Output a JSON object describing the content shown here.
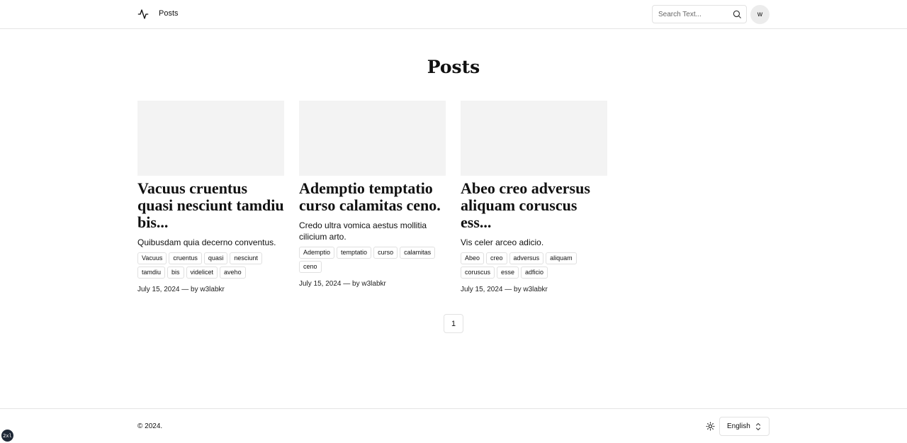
{
  "header": {
    "logo_icon": "activity-pulse-icon",
    "nav": {
      "posts_label": "Posts"
    },
    "search": {
      "placeholder": "Search Text...",
      "value": "",
      "icon": "search-icon"
    },
    "avatar_initial": "w"
  },
  "page": {
    "title": "Posts"
  },
  "posts": [
    {
      "title": "Vacuus cruentus quasi nesciunt tamdiu bis...",
      "description": "Quibusdam quia decerno conventus.",
      "tags": [
        "Vacuus",
        "cruentus",
        "quasi",
        "nesciunt",
        "tamdiu",
        "bis",
        "videlicet",
        "aveho"
      ],
      "meta": "July 15, 2024 — by w3labkr"
    },
    {
      "title": "Ademptio temptatio curso calamitas ceno.",
      "description": "Credo ultra vomica aestus mollitia cilicium arto.",
      "tags": [
        "Ademptio",
        "temptatio",
        "curso",
        "calamitas",
        "ceno"
      ],
      "meta": "July 15, 2024 — by w3labkr"
    },
    {
      "title": "Abeo creo adversus aliquam coruscus ess...",
      "description": "Vis celer arceo adicio.",
      "tags": [
        "Abeo",
        "creo",
        "adversus",
        "aliquam",
        "coruscus",
        "esse",
        "adficio"
      ],
      "meta": "July 15, 2024 — by w3labkr"
    }
  ],
  "pagination": {
    "current_page": "1"
  },
  "footer": {
    "copyright": "© 2024.",
    "theme_icon": "sun-icon",
    "language": {
      "selected": "English",
      "icon": "chevron-up-down-icon"
    }
  },
  "dev_badge": "2xl",
  "colors": {
    "thumb_placeholder": "#f3f3f3",
    "border": "#e5e5e5",
    "avatar_bg": "#ececec"
  }
}
